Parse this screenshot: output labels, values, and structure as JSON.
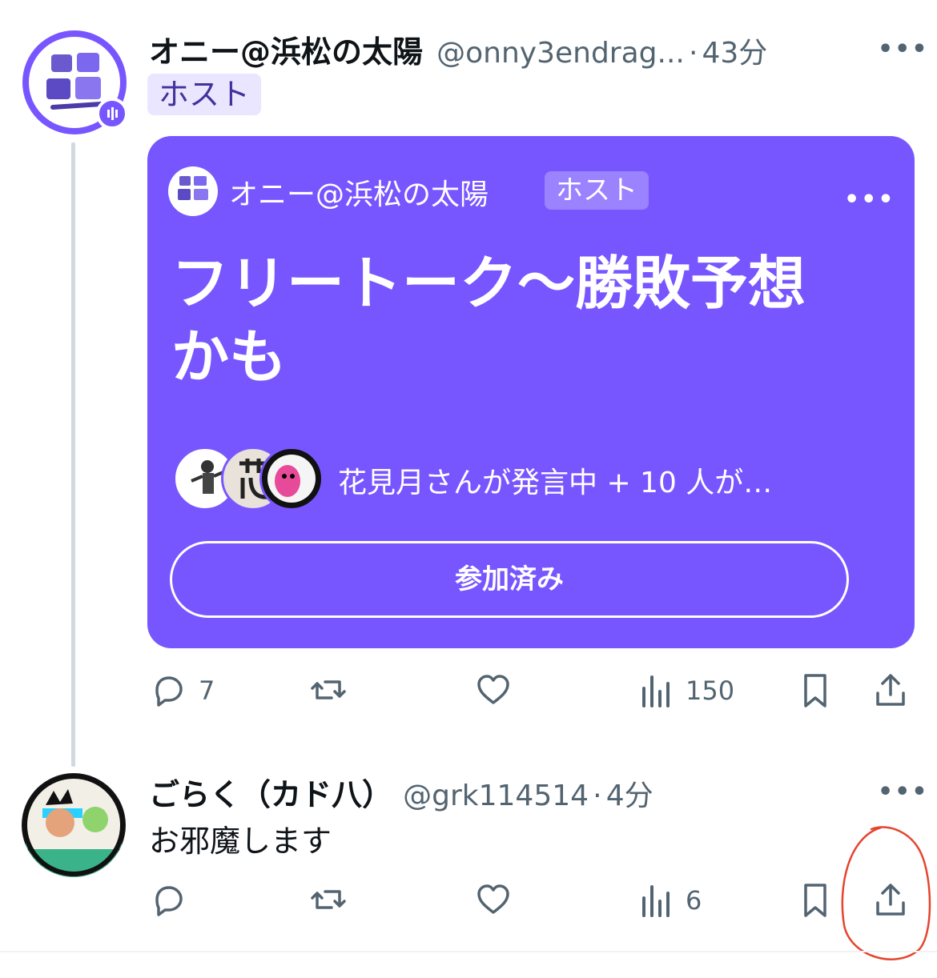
{
  "thread": {
    "post1": {
      "display_name": "オニー@浜松の太陽",
      "handle": "@onny3endrag...",
      "separator": "·",
      "time": "43分",
      "host_badge": "ホスト",
      "more": "•••",
      "space_card": {
        "host_name": "オニー@浜松の太陽",
        "host_badge": "ホスト",
        "more": "•••",
        "title": "フリートーク〜勝敗予想かも",
        "listeners_text": "花見月さんが発言中 + 10 人が…",
        "join_label": "参加済み",
        "accent_color": "#7856ff"
      },
      "actions": {
        "replies": "7",
        "views": "150"
      }
    },
    "post2": {
      "display_name": "ごらく（カド八）",
      "handle": "@grk114514",
      "separator": "·",
      "time": "4分",
      "more": "•••",
      "text": "お邪魔します",
      "actions": {
        "views": "6"
      }
    }
  },
  "icons": [
    "reply-icon",
    "repost-icon",
    "like-icon",
    "views-icon",
    "bookmark-icon",
    "share-icon",
    "more-icon"
  ]
}
